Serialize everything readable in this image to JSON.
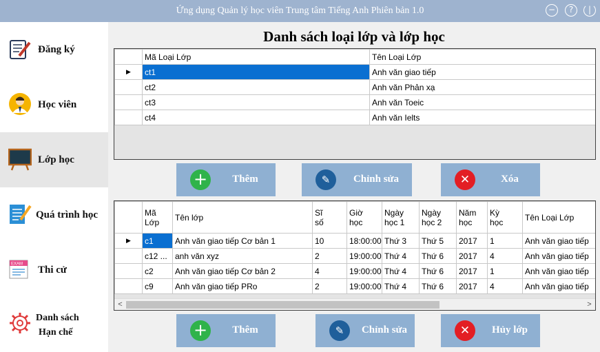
{
  "window": {
    "title": "Ứng dụng Quản lý học viên Trung tâm Tiếng Anh Phiên bản 1.0",
    "controls": [
      "minimize",
      "help",
      "power"
    ]
  },
  "sidebar": {
    "items": [
      {
        "label": "Đăng ký",
        "icon": "register-notepad-icon"
      },
      {
        "label": "Học viên",
        "icon": "student-avatar-icon"
      },
      {
        "label": "Lớp học",
        "icon": "chalkboard-icon",
        "active": true
      },
      {
        "label": "Quá trình học",
        "icon": "learning-progress-icon"
      },
      {
        "label": "Thi cử",
        "icon": "exam-paper-icon"
      },
      {
        "label_line1": "Danh sách",
        "label_line2": "Hạn chế",
        "icon": "gear-icon"
      }
    ]
  },
  "main": {
    "heading": "Danh sách loại lớp và lớp học",
    "class_types": {
      "columns": [
        "Mã Loại Lớp",
        "Tên Loại Lớp"
      ],
      "rows": [
        [
          "ct1",
          "Anh văn giao tiếp"
        ],
        [
          "ct2",
          "Anh văn Phản xạ"
        ],
        [
          "ct3",
          "Anh văn Toeic"
        ],
        [
          "ct4",
          "Anh văn Ielts"
        ]
      ],
      "current_row_marker": "▶"
    },
    "top_buttons": {
      "add": "Thêm",
      "edit": "Chỉnh sửa",
      "delete": "Xóa"
    },
    "classes": {
      "columns": [
        {
          "line1": "Mã",
          "line2": "Lớp"
        },
        {
          "line1": "Tên lớp",
          "line2": ""
        },
        {
          "line1": "Sĩ",
          "line2": "số"
        },
        {
          "line1": "Giờ",
          "line2": "học"
        },
        {
          "line1": "Ngày",
          "line2": "học 1"
        },
        {
          "line1": "Ngày",
          "line2": "học 2"
        },
        {
          "line1": "Năm",
          "line2": "học"
        },
        {
          "line1": "Kỳ",
          "line2": "học"
        },
        {
          "line1": "Tên Loại Lớp",
          "line2": ""
        }
      ],
      "rows": [
        [
          "c1",
          "Anh văn giao tiếp Cơ bản 1",
          "10",
          "18:00:00",
          "Thứ 3",
          "Thứ 5",
          "2017",
          "1",
          "Anh văn giao tiếp"
        ],
        [
          "c12    ...",
          "anh văn xyz",
          "2",
          "19:00:00",
          "Thứ 4",
          "Thứ 6",
          "2017",
          "4",
          "Anh văn giao tiếp"
        ],
        [
          "c2",
          "Anh văn giao tiếp Cơ bản 2",
          "4",
          "19:00:00",
          "Thứ 4",
          "Thứ 6",
          "2017",
          "1",
          "Anh văn giao tiếp"
        ],
        [
          "c9",
          "Anh văn giao tiếp PRo",
          "2",
          "19:00:00",
          "Thứ 4",
          "Thứ 6",
          "2017",
          "4",
          "Anh văn giao tiếp"
        ]
      ],
      "current_row_marker": "▶",
      "scroll_left": "<",
      "scroll_right": ">"
    },
    "bottom_buttons": {
      "add": "Thêm",
      "edit": "Chỉnh sửa",
      "cancel": "Hủy lớp"
    }
  },
  "colors": {
    "titlebar": "#9eb3cf",
    "button_bg": "#8fb0d2",
    "add_icon": "#2fb34a",
    "edit_icon": "#1f5f9b",
    "delete_icon": "#e31e24",
    "selection": "#0a6fd1"
  }
}
